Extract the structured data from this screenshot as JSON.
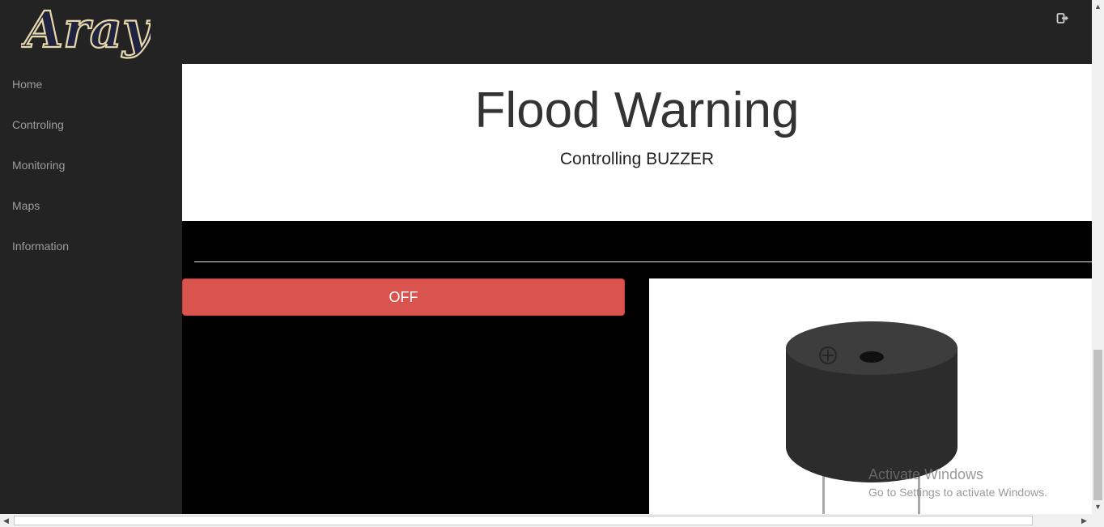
{
  "brand": {
    "logo_text": "Aray"
  },
  "header": {
    "logout_icon": "logout-icon"
  },
  "sidebar": {
    "items": [
      {
        "label": "Home"
      },
      {
        "label": "Controling"
      },
      {
        "label": "Monitoring"
      },
      {
        "label": "Maps"
      },
      {
        "label": "Information"
      }
    ]
  },
  "hero": {
    "title": "Flood Warning",
    "subtitle": "Controlling BUZZER"
  },
  "control": {
    "button_label": "OFF",
    "button_color": "#d9534f"
  },
  "image": {
    "icon": "buzzer-image"
  },
  "os_overlay": {
    "line1": "Activate Windows",
    "line2": "Go to Settings to activate Windows."
  },
  "colors": {
    "nav_bg": "#232323",
    "hero_bg": "#ffffff",
    "content_bg": "#000000"
  }
}
